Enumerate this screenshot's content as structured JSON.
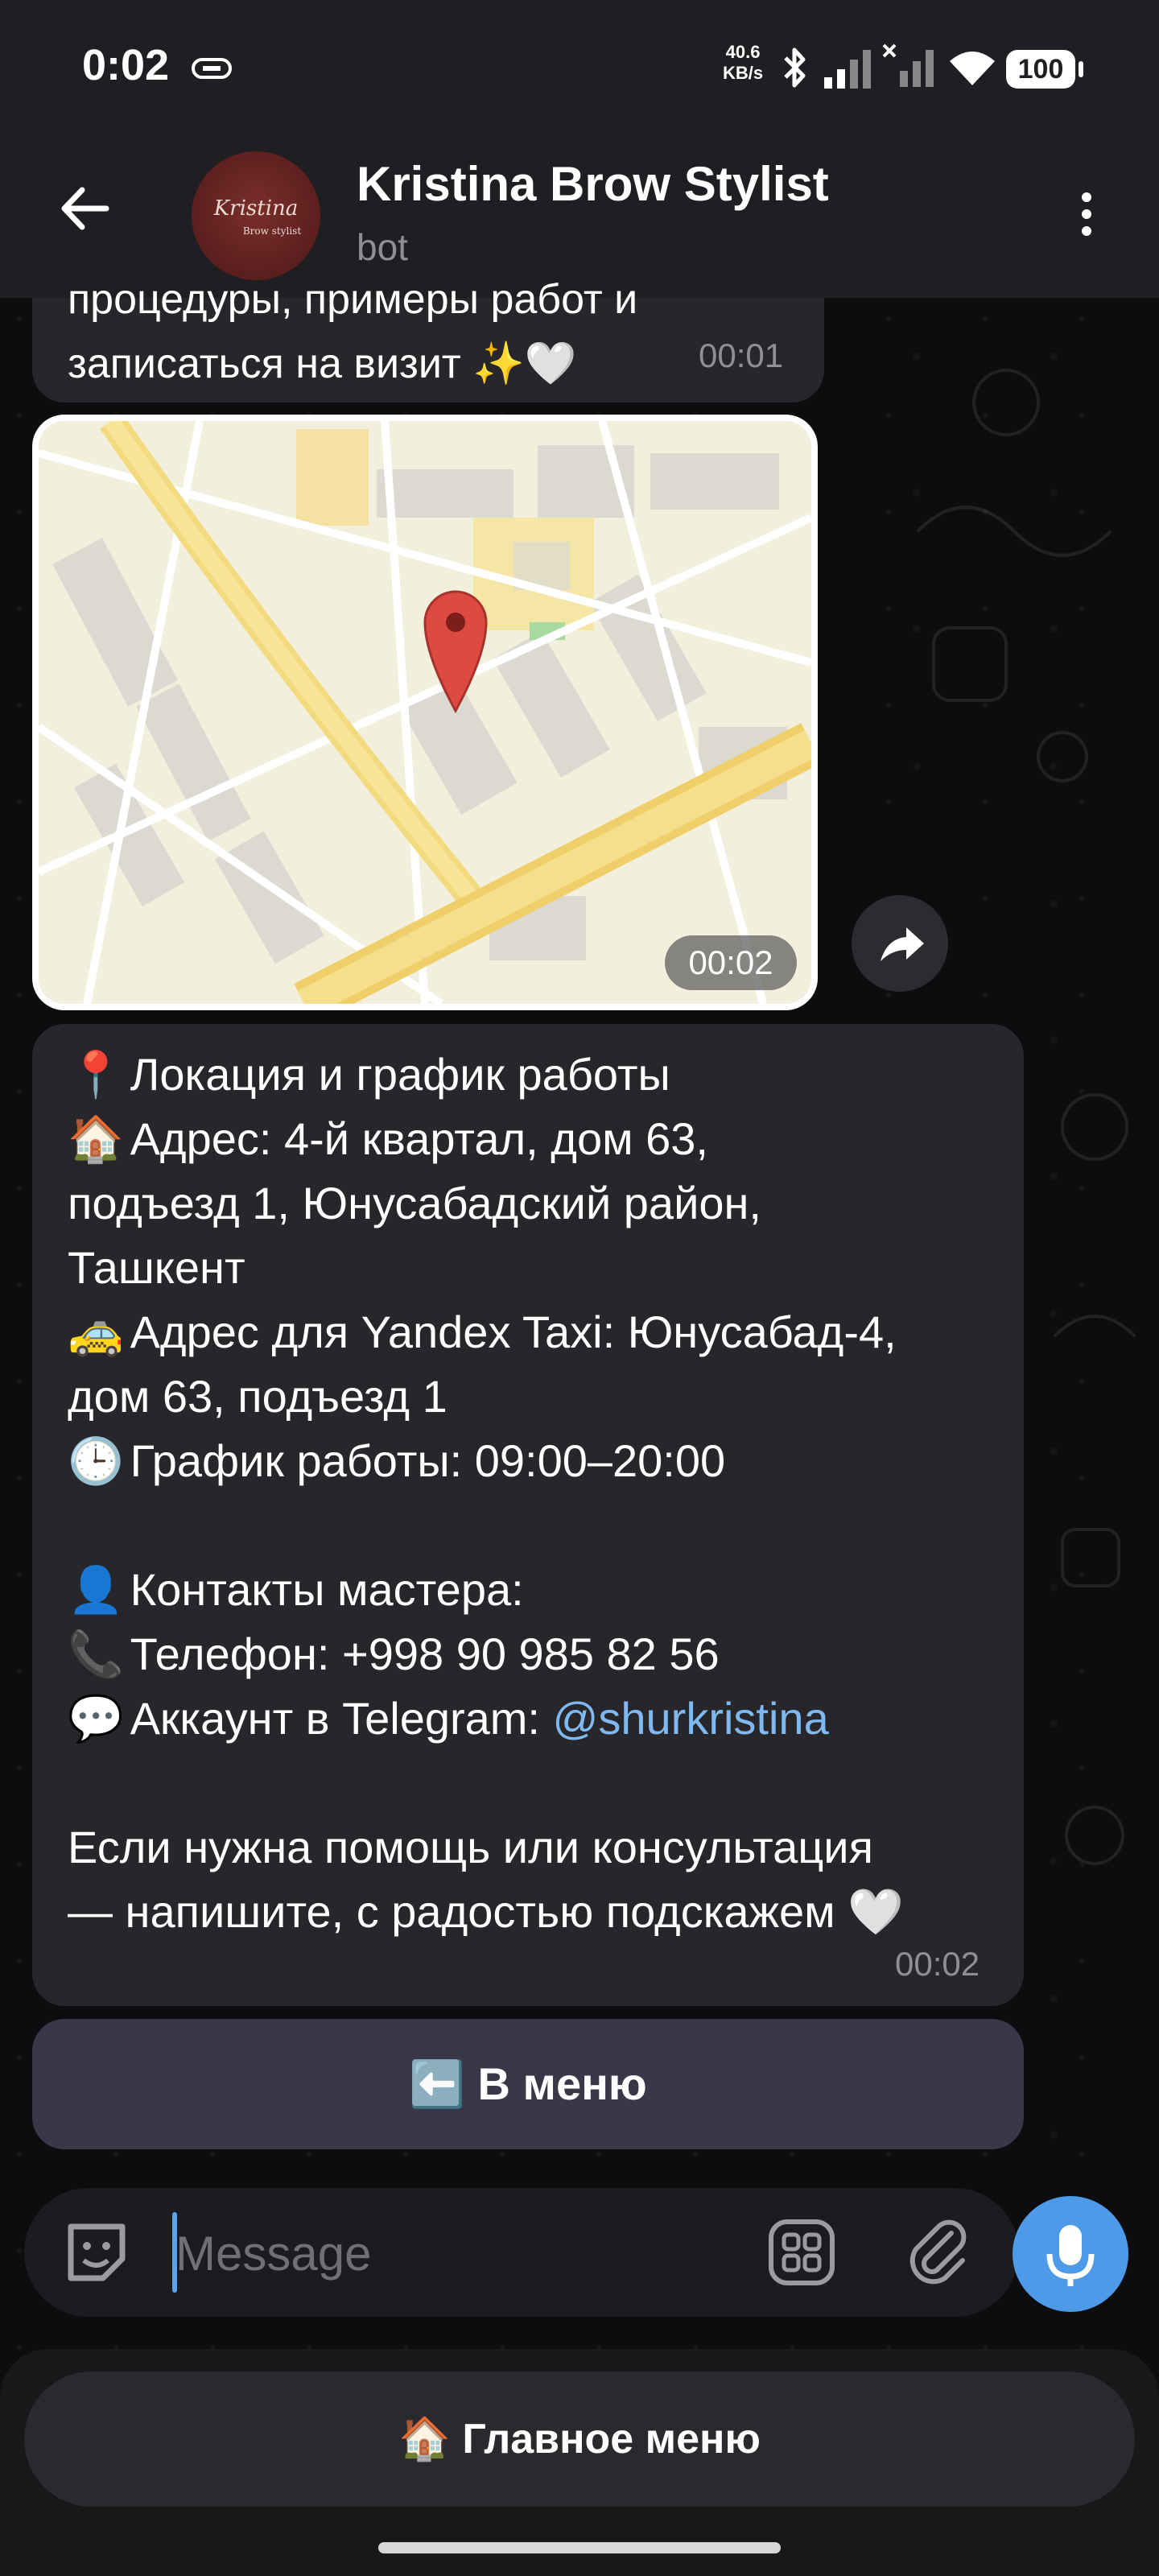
{
  "status_bar": {
    "time": "0:02",
    "net_speed_value": "40.6",
    "net_speed_unit": "KB/s",
    "battery": "100"
  },
  "header": {
    "title": "Kristina Brow Stylist",
    "subtitle": "bot",
    "avatar_text": "Kristina",
    "avatar_subtext": "Brow stylist"
  },
  "messages": {
    "top": {
      "text": "процедуры, примеры работ и\nзаписаться на визит ✨🤍",
      "time": "00:01"
    },
    "map": {
      "time": "00:02"
    },
    "location": {
      "lines": [
        {
          "emoji": "📍",
          "text": "Локация и график работы"
        },
        {
          "emoji": "🏠",
          "text": "Адрес: 4-й квартал, дом 63,"
        },
        {
          "emoji": "",
          "text": "подъезд 1, Юнусабадский район,"
        },
        {
          "emoji": "",
          "text": "Ташкент"
        },
        {
          "emoji": "🚕",
          "text": "Адрес для Yandex Taxi: Юнусабад-4,"
        },
        {
          "emoji": "",
          "text": "дом 63, подъезд 1"
        },
        {
          "emoji": "🕒",
          "text": "График работы: 09:00–20:00"
        },
        {
          "emoji": "👤",
          "text": "Контакты мастера:"
        },
        {
          "emoji": "📞",
          "text": "Телефон: +998 90 985 82 56"
        },
        {
          "emoji": "💬",
          "text": "Аккаунт в Telegram: "
        },
        {
          "emoji": "",
          "text": "Если нужна помощь или консультация"
        },
        {
          "emoji": "",
          "text": "— напишите, с радостью подскажем 🤍"
        }
      ],
      "telegram_handle": "@shurkristina",
      "time": "00:02"
    }
  },
  "buttons": {
    "menu": "⬅️ В меню",
    "main_menu": "🏠 Главное меню"
  },
  "composer": {
    "placeholder": "Message"
  },
  "icons": [
    "back-arrow-icon",
    "menu-kebab-icon",
    "share-icon",
    "sticker-icon",
    "apps-grid-icon",
    "attach-icon",
    "mic-icon",
    "map-pin-icon"
  ],
  "colors": {
    "bubble": "#26262b",
    "link": "#7fb9ef",
    "accent": "#4d9be8",
    "header": "#1f1f23"
  }
}
